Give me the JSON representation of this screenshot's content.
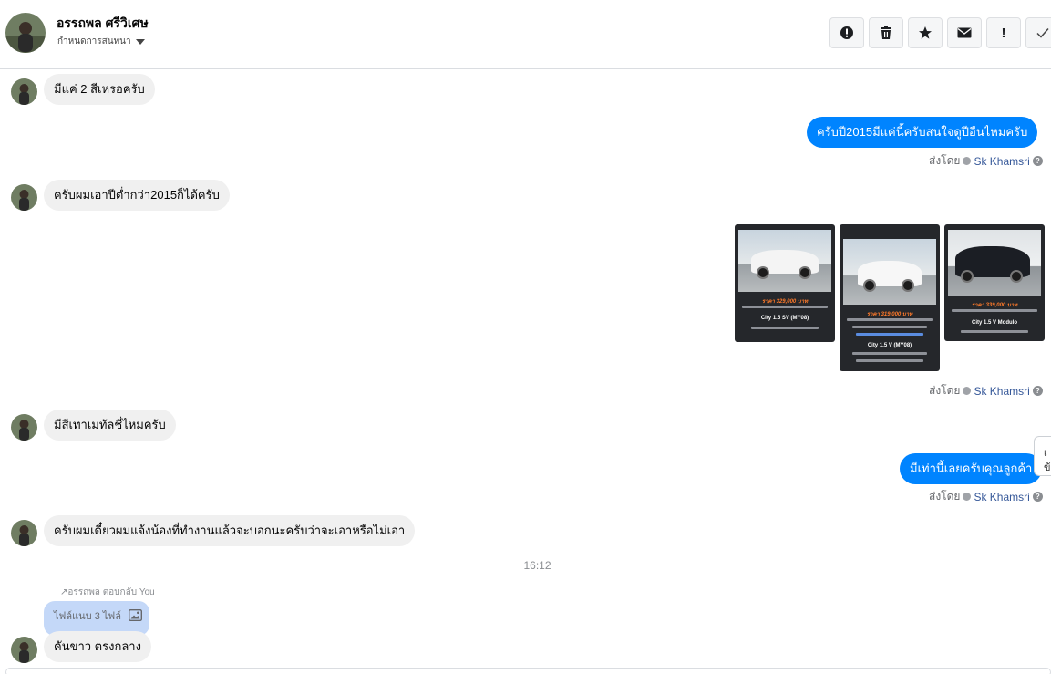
{
  "header": {
    "contact_name": "อรรถพล ศรีวิเศษ",
    "conversation_settings": "กำหนดการสนทนา",
    "toolbar": [
      {
        "icon": "report-icon",
        "label": "!"
      },
      {
        "icon": "trash-icon",
        "label": ""
      },
      {
        "icon": "star-icon",
        "label": ""
      },
      {
        "icon": "envelope-icon",
        "label": ""
      },
      {
        "icon": "exclamation-icon",
        "label": "!"
      },
      {
        "icon": "checkmark-icon",
        "label": ""
      }
    ]
  },
  "messages": {
    "m1": "มีแค่ 2 สีเหรอครับ",
    "m2": "ครับปี2015มีแค่นี้ครับสนใจดูปีอื่นไหมครับ",
    "m3": "ครับผมเอาปีต่ำกว่า2015ก็ได้ครับ",
    "m4": "มีสีเทาเมทัลชี่ไหมครับ",
    "m5": "มีเท่านี้เลยครับคุณลูกค้า",
    "m6": "ครับผมเดี๋ยวผมแจ้งน้องที่ทำงานแล้วจะบอกนะครับว่าจะเอาหรือไม่เอา",
    "m7": "คันขาว ตรงกลาง"
  },
  "sent_by": {
    "prefix": "ส่งโดย",
    "agent": "Sk Khamsri"
  },
  "image_cards": [
    {
      "price": "ราคา 329,000 บาท",
      "model": "City 1.5 SV (MY08)",
      "car_color": "#f4f4f4"
    },
    {
      "price": "ราคา 319,000 บาท",
      "model": "City 1.5 V (MY08)",
      "car_color": "#f7f7f7"
    },
    {
      "price": "ราคา 339,000 บาท",
      "model": "City 1.5 V Modulo",
      "car_color": "#1b1e24"
    }
  ],
  "time_separator": "16:12",
  "reply": {
    "note": "อรรถพล ตอบกลับ You",
    "attachment_label": "ไฟล์แนบ 3 ไฟล์"
  },
  "side_tab": {
    "line1": "เ",
    "line2": "ข้"
  },
  "colors": {
    "outgoing_bubble": "#0084ff",
    "incoming_bubble": "#f0f0f0",
    "reply_bubble": "#c4d8f8",
    "price_text": "#ff7a2a"
  }
}
